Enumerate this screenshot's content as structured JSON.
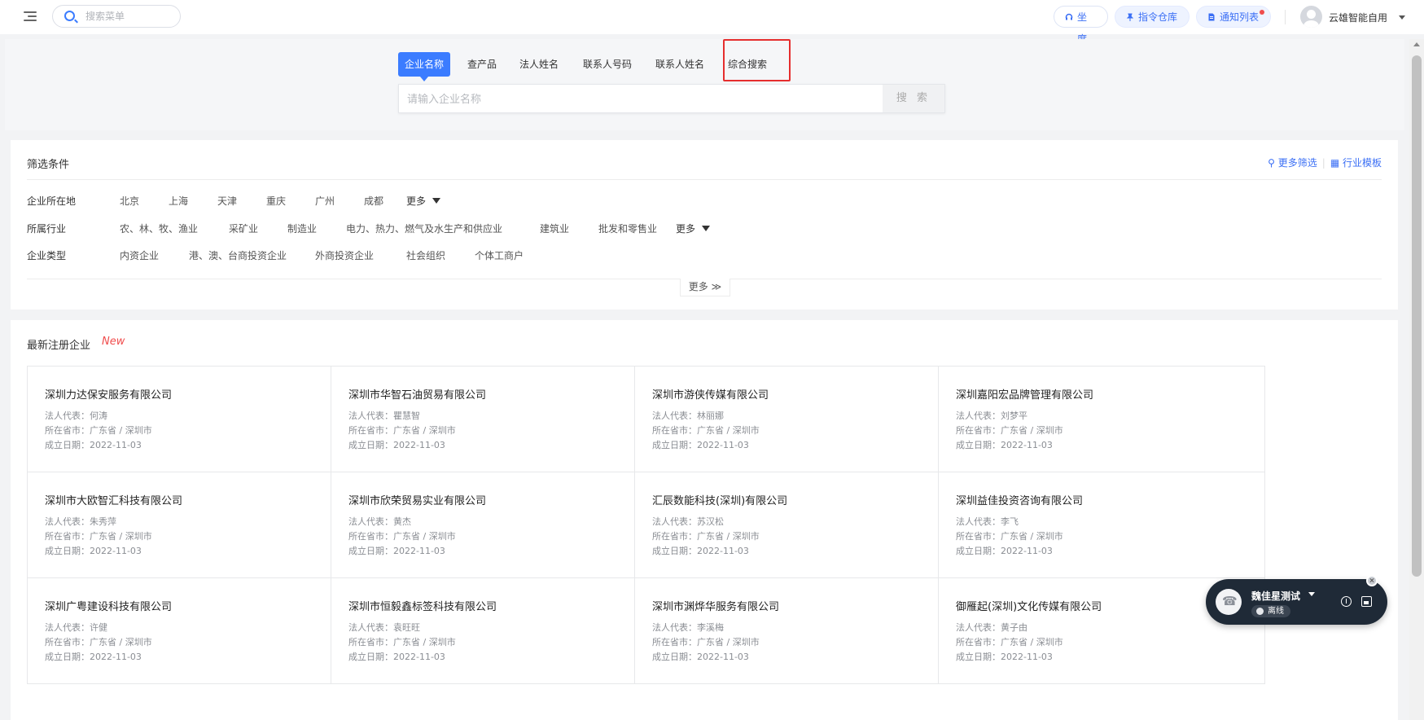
{
  "header": {
    "search_placeholder": "搜索菜单",
    "buttons": [
      {
        "label": "坐席",
        "icon": "headset-icon"
      },
      {
        "label": "指令仓库",
        "icon": "pin-icon"
      },
      {
        "label": "通知列表",
        "icon": "document-icon"
      }
    ],
    "user_name": "云雄智能自用"
  },
  "search": {
    "tabs": [
      "企业名称",
      "查产品",
      "法人姓名",
      "联系人号码",
      "联系人姓名",
      "综合搜索"
    ],
    "active_tab": "企业名称",
    "input_placeholder": "请输入企业名称",
    "button_label": "搜 索"
  },
  "filters": {
    "title": "筛选条件",
    "more_filter": "更多筛选",
    "industry_template": "行业模板",
    "rows": [
      {
        "label": "企业所在地",
        "options": [
          "北京",
          "上海",
          "天津",
          "重庆",
          "广州",
          "成都"
        ],
        "more": "更多"
      },
      {
        "label": "所属行业",
        "options": [
          "农、林、牧、渔业",
          "采矿业",
          "制造业",
          "电力、热力、燃气及水生产和供应业",
          "建筑业",
          "批发和零售业"
        ],
        "more": "更多"
      },
      {
        "label": "企业类型",
        "options": [
          "内资企业",
          "港、澳、台商投资企业",
          "外商投资企业",
          "社会组织",
          "个体工商户"
        ],
        "more": ""
      }
    ],
    "expand_label": "更多 ≫"
  },
  "companies": {
    "title": "最新注册企业",
    "badge": "New",
    "labels": {
      "legal": "法人代表：",
      "location": "所在省市：",
      "date": "成立日期："
    },
    "items": [
      {
        "name": "深圳力达保安服务有限公司",
        "legal": "何涛",
        "location": "广东省 / 深圳市",
        "date": "2022-11-03"
      },
      {
        "name": "深圳市华智石油贸易有限公司",
        "legal": "瞿慧智",
        "location": "广东省 / 深圳市",
        "date": "2022-11-03"
      },
      {
        "name": "深圳市游侠传媒有限公司",
        "legal": "林丽娜",
        "location": "广东省 / 深圳市",
        "date": "2022-11-03"
      },
      {
        "name": "深圳嘉阳宏品牌管理有限公司",
        "legal": "刘梦平",
        "location": "广东省 / 深圳市",
        "date": "2022-11-03"
      },
      {
        "name": "深圳市大欧智汇科技有限公司",
        "legal": "朱秀萍",
        "location": "广东省 / 深圳市",
        "date": "2022-11-03"
      },
      {
        "name": "深圳市欣荣贸易实业有限公司",
        "legal": "黄杰",
        "location": "广东省 / 深圳市",
        "date": "2022-11-03"
      },
      {
        "name": "汇辰数能科技(深圳)有限公司",
        "legal": "苏汉松",
        "location": "广东省 / 深圳市",
        "date": "2022-11-03"
      },
      {
        "name": "深圳益佳投资咨询有限公司",
        "legal": "李飞",
        "location": "广东省 / 深圳市",
        "date": "2022-11-03"
      },
      {
        "name": "深圳广粤建设科技有限公司",
        "legal": "许健",
        "location": "广东省 / 深圳市",
        "date": "2022-11-03"
      },
      {
        "name": "深圳市恒毅鑫标签科技有限公司",
        "legal": "袁旺旺",
        "location": "广东省 / 深圳市",
        "date": "2022-11-03"
      },
      {
        "name": "深圳市渊烨华服务有限公司",
        "legal": "李溪梅",
        "location": "广东省 / 深圳市",
        "date": "2022-11-03"
      },
      {
        "name": "御雁起(深圳)文化传媒有限公司",
        "legal": "黄子由",
        "location": "广东省 / 深圳市",
        "date": "2022-11-03"
      }
    ]
  },
  "call_widget": {
    "agent_name": "魏佳星测试",
    "status": "离线"
  },
  "colors": {
    "accent": "#3b7cff",
    "highlight": "#e52e2e",
    "new_badge": "#f04c4c"
  }
}
